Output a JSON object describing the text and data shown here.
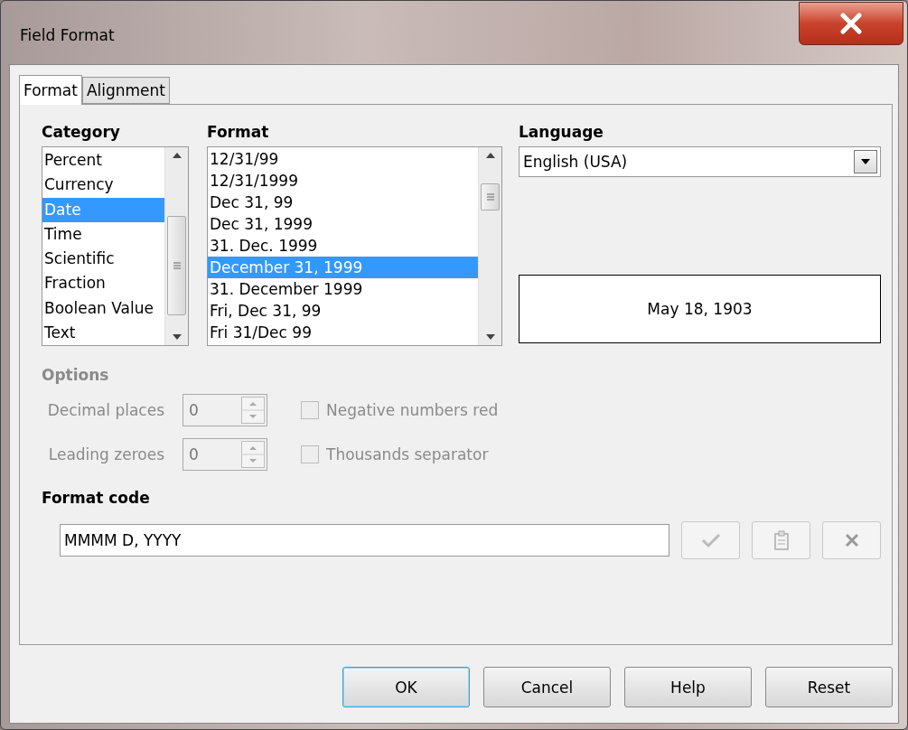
{
  "window": {
    "title": "Field Format"
  },
  "tabs": [
    {
      "label": "Format",
      "selected": true
    },
    {
      "label": "Alignment",
      "selected": false
    }
  ],
  "category": {
    "label": "Category",
    "items": [
      {
        "label": "Percent",
        "selected": false
      },
      {
        "label": "Currency",
        "selected": false
      },
      {
        "label": "Date",
        "selected": true
      },
      {
        "label": "Time",
        "selected": false
      },
      {
        "label": "Scientific",
        "selected": false
      },
      {
        "label": "Fraction",
        "selected": false
      },
      {
        "label": "Boolean Value",
        "selected": false
      },
      {
        "label": "Text",
        "selected": false
      }
    ]
  },
  "format": {
    "label": "Format",
    "items": [
      {
        "label": "12/31/99",
        "selected": false
      },
      {
        "label": "12/31/1999",
        "selected": false
      },
      {
        "label": "Dec 31, 99",
        "selected": false
      },
      {
        "label": "Dec 31, 1999",
        "selected": false
      },
      {
        "label": "31. Dec. 1999",
        "selected": false
      },
      {
        "label": "December 31, 1999",
        "selected": true
      },
      {
        "label": "31. December 1999",
        "selected": false
      },
      {
        "label": "Fri, Dec 31, 99",
        "selected": false
      },
      {
        "label": "Fri 31/Dec 99",
        "selected": false
      }
    ]
  },
  "language": {
    "label": "Language",
    "value": "English (USA)"
  },
  "preview": "May 18, 1903",
  "options": {
    "label": "Options",
    "disabled": true,
    "rows": [
      {
        "label": "Decimal places",
        "value": "0",
        "checkbox_label": "Negative numbers red",
        "checked": false
      },
      {
        "label": "Leading zeroes",
        "value": "0",
        "checkbox_label": "Thousands separator",
        "checked": false
      }
    ]
  },
  "format_code": {
    "label": "Format code",
    "value": "MMMM D, YYYY"
  },
  "buttons": [
    {
      "label": "OK",
      "default": true
    },
    {
      "label": "Cancel",
      "default": false
    },
    {
      "label": "Help",
      "default": false
    },
    {
      "label": "Reset",
      "default": false
    }
  ]
}
